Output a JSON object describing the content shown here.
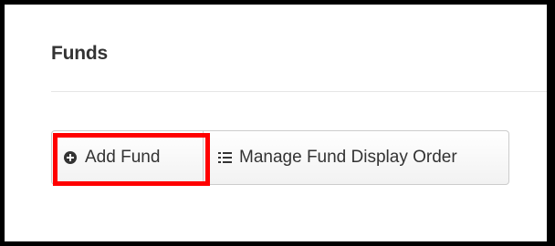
{
  "panel": {
    "title": "Funds"
  },
  "toolbar": {
    "add_label": "Add Fund",
    "add_icon": "plus-circle-icon",
    "manage_label": "Manage Fund Display Order",
    "manage_icon": "list-icon"
  },
  "annotation": {
    "highlight_color": "#ff0000"
  }
}
